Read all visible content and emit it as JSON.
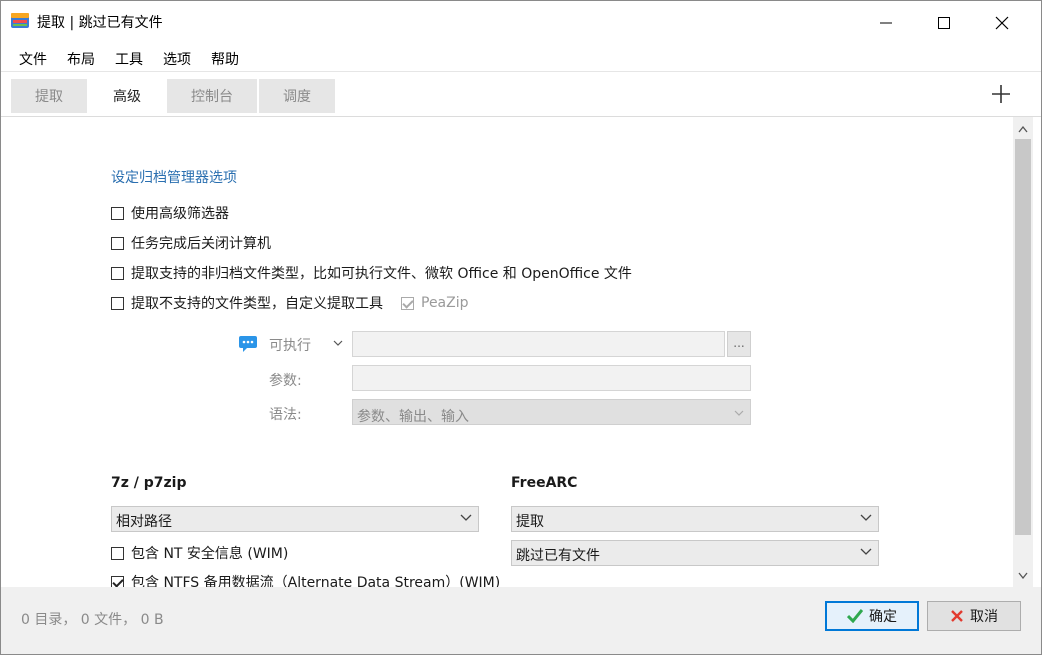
{
  "window": {
    "title": "提取 | 跳过已有文件"
  },
  "menu": [
    "文件",
    "布局",
    "工具",
    "选项",
    "帮助"
  ],
  "tabs": [
    {
      "label": "提取",
      "active": false
    },
    {
      "label": "高级",
      "active": true
    },
    {
      "label": "控制台",
      "active": false
    },
    {
      "label": "调度",
      "active": false
    }
  ],
  "advanced": {
    "section_link": "设定归档管理器选项",
    "checkboxes": [
      {
        "label": "使用高级筛选器",
        "checked": false
      },
      {
        "label": "任务完成后关闭计算机",
        "checked": false
      },
      {
        "label": "提取支持的非归档文件类型，比如可执行文件、微软 Office 和 OpenOffice 文件",
        "checked": false
      },
      {
        "label": "提取不支持的文件类型，自定义提取工具",
        "checked": false
      }
    ],
    "peazip_option": {
      "label": "PeaZip",
      "checked": true,
      "disabled": true
    },
    "custom_tool": {
      "executable_label": "可执行",
      "executable_value": "",
      "browse_label": "...",
      "params_label": "参数:",
      "params_value": "",
      "syntax_label": "语法:",
      "syntax_value": "参数、输出、输入"
    },
    "sevenzip": {
      "heading": "7z / p7zip",
      "path_mode": "相对路径",
      "checkboxes": [
        {
          "label": "包含 NT 安全信息 (WIM)",
          "checked": false
        },
        {
          "label": "包含 NTFS 备用数据流（Alternate Data Stream）(WIM)",
          "checked": true
        }
      ]
    },
    "freearc": {
      "heading": "FreeARC",
      "action": "提取",
      "overwrite": "跳过已有文件"
    }
  },
  "footer": {
    "status": "0 目录， 0 文件， 0 B",
    "ok_label": "确定",
    "cancel_label": "取消"
  },
  "colors": {
    "accent": "#0078d7",
    "link": "#2a6fb0",
    "ok_icon": "#2fa84f",
    "cancel_icon": "#e23a2e"
  }
}
